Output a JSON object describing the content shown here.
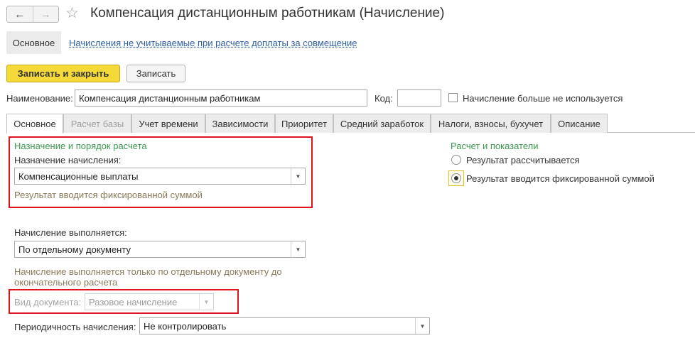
{
  "window": {
    "title": "Компенсация дистанционным работникам (Начисление)",
    "nav_back_icon": "←",
    "nav_forward_icon": "→",
    "favorite_icon": "☆"
  },
  "sections": {
    "main": "Основное",
    "link": "Начисления не учитываемые при расчете доплаты за совмещение"
  },
  "toolbar": {
    "save_close": "Записать и закрыть",
    "save": "Записать"
  },
  "header": {
    "name_label": "Наименование:",
    "name_value": "Компенсация дистанционным работникам",
    "code_label": "Код:",
    "code_value": "",
    "unused_label": "Начисление больше не используется"
  },
  "tabs": [
    "Основное",
    "Расчет базы",
    "Учет времени",
    "Зависимости",
    "Приоритет",
    "Средний заработок",
    "Налоги, взносы, бухучет",
    "Описание"
  ],
  "purpose": {
    "group_title": "Назначение и порядок расчета",
    "field_label": "Назначение начисления:",
    "field_value": "Компенсационные выплаты",
    "note": "Результат вводится фиксированной суммой"
  },
  "execution": {
    "label": "Начисление выполняется:",
    "value": "По отдельному документу",
    "note_line1": "Начисление выполняется только по отдельному документу до",
    "note_line2": "окончательного расчета",
    "doc_type_label": "Вид документа:",
    "doc_type_value": "Разовое начисление",
    "periodicity_label": "Периодичность начисления:",
    "periodicity_value": "Не контролировать"
  },
  "calc": {
    "group_title": "Расчет и показатели",
    "option1": "Результат рассчитывается",
    "option2": "Результат вводится фиксированной суммой",
    "selected": 2
  },
  "colors": {
    "accent_yellow": "#f5d938",
    "group_green": "#3b9a4f",
    "note_brown": "#8b7a5b",
    "highlight_red": "#e0141e",
    "link_blue": "#2f5fa3"
  }
}
